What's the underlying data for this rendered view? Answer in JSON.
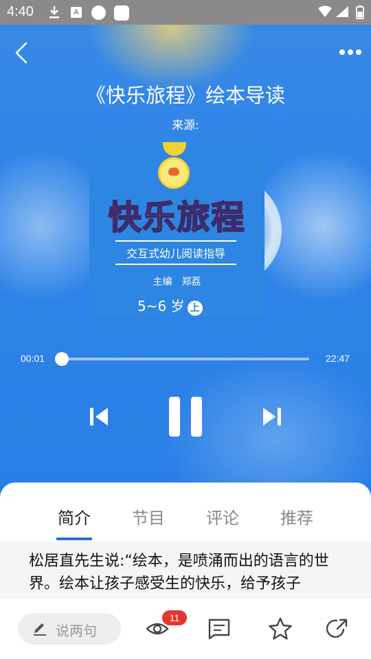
{
  "status_bar": {
    "time": "4:40"
  },
  "header": {
    "title": "《快乐旅程》绘本导读",
    "source_label": "来源:"
  },
  "cover": {
    "title_chars": [
      "快",
      "乐",
      "旅",
      "程"
    ],
    "subtitle": "交互式幼儿阅读指导",
    "editor": "主编　郑荔",
    "age": "5~6 岁",
    "volume": "上"
  },
  "player": {
    "current_time": "00:01",
    "total_time": "22:47",
    "progress_fraction": 0.0007
  },
  "tabs": [
    {
      "label": "简介",
      "active": true
    },
    {
      "label": "节目",
      "active": false
    },
    {
      "label": "评论",
      "active": false
    },
    {
      "label": "推荐",
      "active": false
    }
  ],
  "intro_text": "松居直先生说:“绘本，是喷涌而出的语言的世界。绘本让孩子感受生的快乐，给予孩子",
  "bottom_bar": {
    "comment_placeholder": "说两句",
    "view_count": "11"
  },
  "colors": {
    "accent": "#2a6fd6",
    "badge": "#e6352b",
    "background": "#2a7fe6"
  },
  "icons": [
    "download-icon",
    "font-icon",
    "wifi-icon",
    "signal-icon",
    "battery-icon",
    "back-icon",
    "more-icon",
    "previous-icon",
    "pause-icon",
    "next-icon",
    "pen-icon",
    "eye-icon",
    "comment-icon",
    "star-icon",
    "share-icon"
  ]
}
